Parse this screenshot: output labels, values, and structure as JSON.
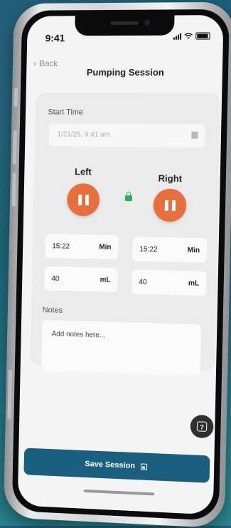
{
  "status_bar": {
    "time": "9:41"
  },
  "header": {
    "back_label": "Back",
    "title": "Pumping Session"
  },
  "form": {
    "start_time_label": "Start Time",
    "start_time_value": "1/21/25, 9:41 am",
    "left": {
      "title": "Left",
      "time_value": "15:22",
      "time_unit": "Min",
      "volume_value": "40",
      "volume_unit": "mL"
    },
    "right": {
      "title": "Right",
      "time_value": "15:22",
      "time_unit": "Min",
      "volume_value": "40",
      "volume_unit": "mL"
    },
    "notes_label": "Notes",
    "notes_placeholder": "Add notes here..."
  },
  "help_button": {
    "label": "?"
  },
  "save_button": {
    "label": "Save Session"
  },
  "colors": {
    "accent": "#E6703D",
    "primary": "#1B5F7E",
    "lock": "#27AE60"
  },
  "icons": [
    "chevron-left-icon",
    "signal-icon",
    "wifi-icon",
    "battery-icon",
    "calendar-icon",
    "pause-icon",
    "lock-icon",
    "help-icon",
    "save-icon"
  ]
}
